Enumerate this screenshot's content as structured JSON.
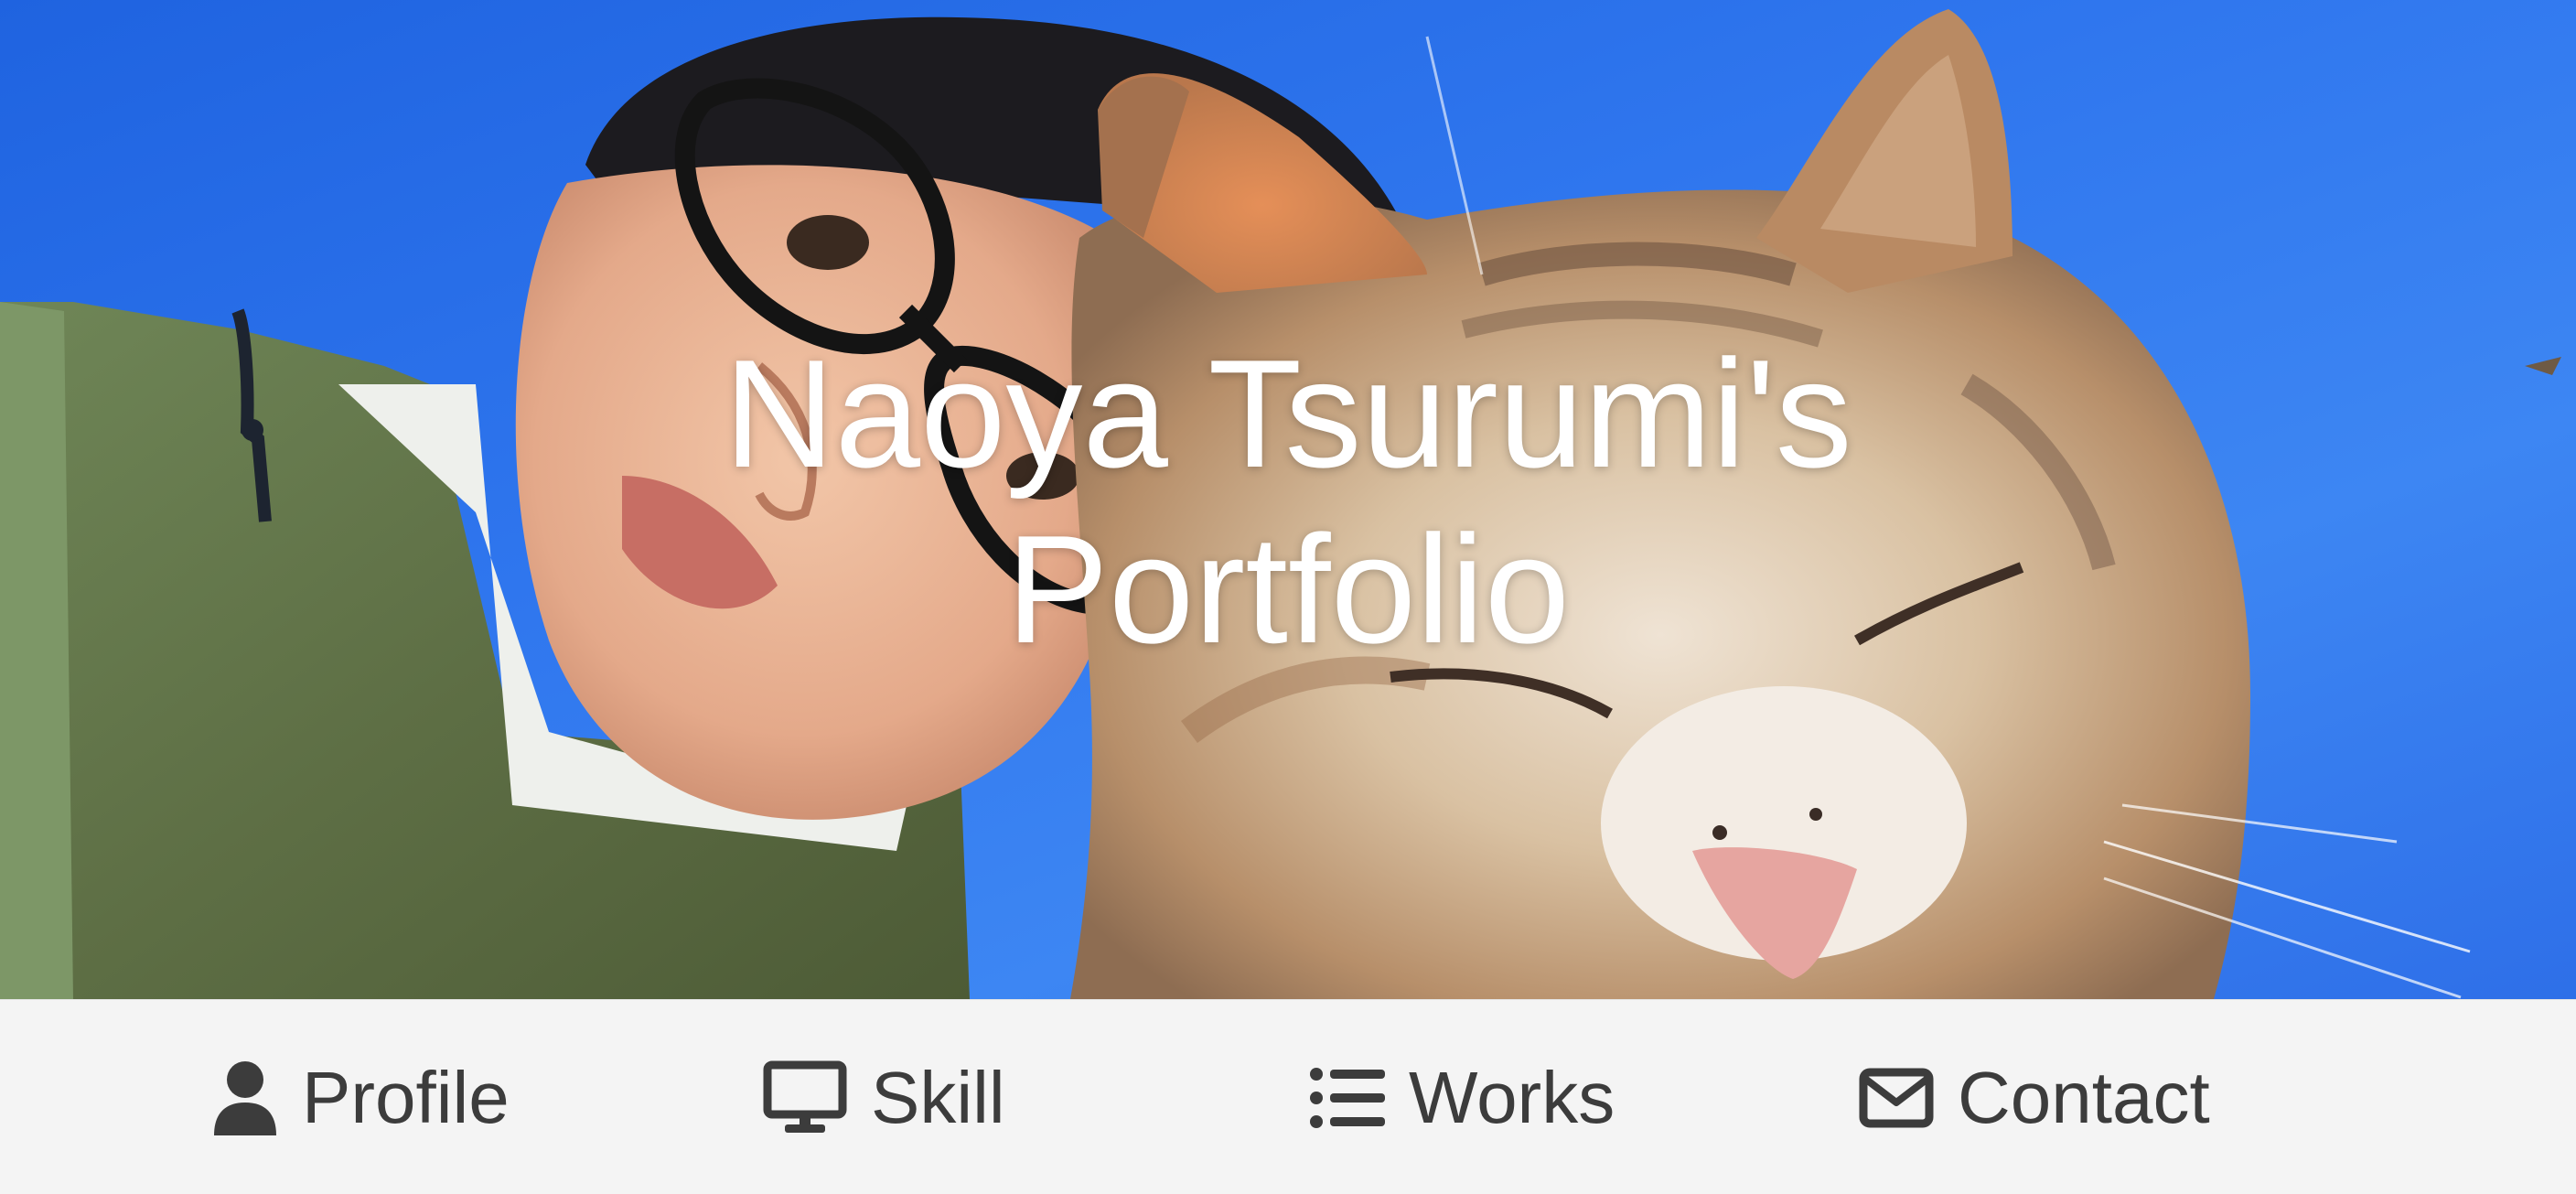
{
  "hero": {
    "title_line1": "Naoya Tsurumi's",
    "title_line2": "Portfolio",
    "background": "photo-of-person-with-cat-under-blue-sky"
  },
  "nav": {
    "items": [
      {
        "label": "Profile",
        "icon": "user-icon"
      },
      {
        "label": "Skill",
        "icon": "desktop-icon"
      },
      {
        "label": "Works",
        "icon": "list-icon"
      },
      {
        "label": "Contact",
        "icon": "envelope-icon"
      }
    ]
  },
  "colors": {
    "sky": "#2f76ee",
    "nav_background": "#f4f4f4",
    "nav_text": "#3c3c3c",
    "title_text": "#ffffff"
  }
}
